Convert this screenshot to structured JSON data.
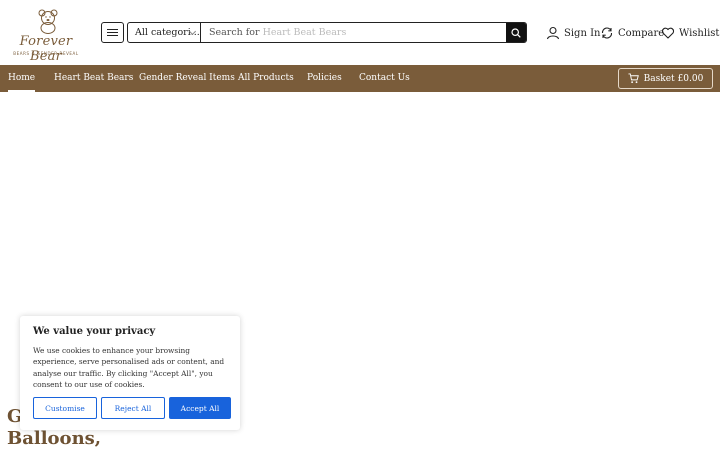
{
  "brand": {
    "name": "Forever Bear",
    "tagline": "BEARS & GENDER REVEAL"
  },
  "search": {
    "category": "All categori...",
    "label": "Search for",
    "hint": "Heart Beat Bears"
  },
  "actions": {
    "sign_in": "Sign In",
    "compare": "Compare",
    "wishlist": "Wishlist"
  },
  "nav": [
    "Home",
    "Heart Beat Bears",
    "Gender Reveal Items",
    "All Products",
    "Policies",
    "Contact Us"
  ],
  "basket": {
    "label": "Basket",
    "amount": "£0.00"
  },
  "hero": {
    "line1": "G",
    "line2": "Balloons,"
  },
  "cookie": {
    "title": "We value your privacy",
    "body": "We use cookies to enhance your browsing experience, serve personalised ads or content, and analyse our traffic. By clicking \"Accept All\", you consent to our use of cookies.",
    "customise": "Customise",
    "reject": "Reject All",
    "accept": "Accept All"
  },
  "colors": {
    "brand_brown": "#7a5c3a",
    "cookie_blue": "#1863dc"
  }
}
